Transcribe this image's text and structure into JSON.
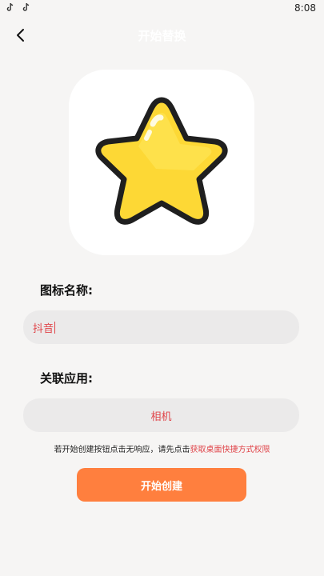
{
  "status_bar": {
    "time": "8:08",
    "left_icons": [
      "tiktok-icon",
      "tiktok-icon"
    ]
  },
  "nav": {
    "title": "开始替换",
    "back_icon": "chevron-left-icon"
  },
  "icon_preview": {
    "icon": "star-icon",
    "fill_color": "#fdd835",
    "outline_color": "#1f1f1f"
  },
  "icon_name": {
    "label": "图标名称:",
    "value": "抖音"
  },
  "linked_app": {
    "label": "关联应用:",
    "value": "相机"
  },
  "hint": {
    "text": "若开始创建按钮点击无响应，请先点击",
    "link": "获取桌面快捷方式权限"
  },
  "create_button": {
    "label": "开始创建"
  },
  "colors": {
    "background": "#f6f5f4",
    "accent_red": "#e0454a",
    "button_orange": "#ff7f3e",
    "field_bg": "#ebeaea"
  }
}
